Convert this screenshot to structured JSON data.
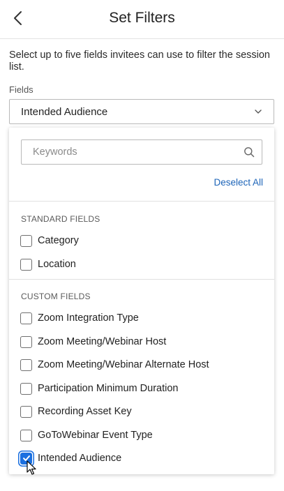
{
  "header": {
    "title": "Set Filters"
  },
  "instructions": "Select up to five fields invitees can use to filter the session list.",
  "fields_label": "Fields",
  "select": {
    "value": "Intended Audience"
  },
  "dropdown": {
    "search_placeholder": "Keywords",
    "deselect_label": "Deselect All",
    "standard_title": "STANDARD FIELDS",
    "standard_items": [
      {
        "label": "Category",
        "checked": false
      },
      {
        "label": "Location",
        "checked": false
      }
    ],
    "custom_title": "CUSTOM FIELDS",
    "custom_items": [
      {
        "label": "Zoom Integration Type",
        "checked": false
      },
      {
        "label": "Zoom Meeting/Webinar Host",
        "checked": false
      },
      {
        "label": "Zoom Meeting/Webinar Alternate Host",
        "checked": false
      },
      {
        "label": "Participation Minimum Duration",
        "checked": false
      },
      {
        "label": "Recording Asset Key",
        "checked": false
      },
      {
        "label": "GoToWebinar Event Type",
        "checked": false
      },
      {
        "label": "Intended Audience",
        "checked": true
      }
    ]
  },
  "colors": {
    "accent": "#1a6fe0",
    "link": "#1d64b8"
  },
  "icons": {
    "back": "chevron-left-icon",
    "select": "chevron-down-icon",
    "search": "search-icon",
    "check": "check-icon"
  }
}
